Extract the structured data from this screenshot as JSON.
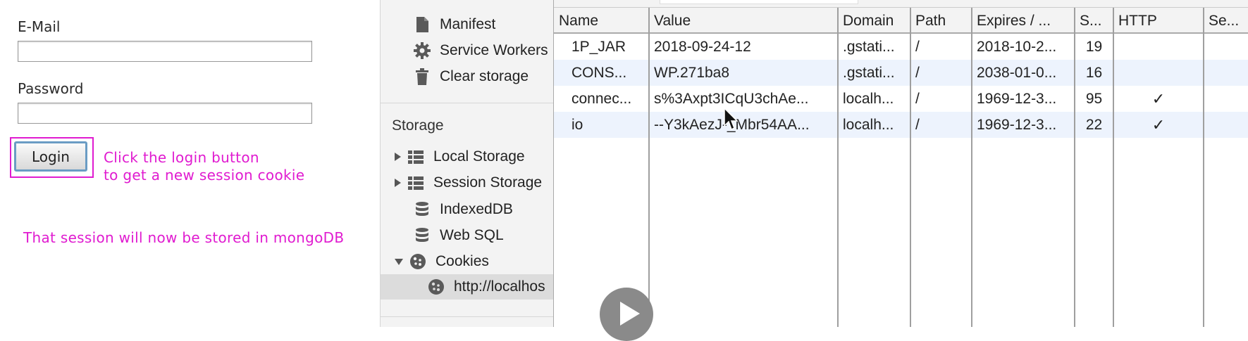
{
  "login_form": {
    "email_label": "E-Mail",
    "email_value": "",
    "password_label": "Password",
    "password_value": "",
    "login_button_label": "Login",
    "annotation_line1": "Click the login button",
    "annotation_line2": "to get a new session cookie",
    "annotation_bottom": "That session will now be stored in mongoDB"
  },
  "sidebar": {
    "application_items": [
      {
        "label": "Manifest",
        "icon": "document-icon"
      },
      {
        "label": "Service Workers",
        "icon": "gear-icon"
      },
      {
        "label": "Clear storage",
        "icon": "trash-icon"
      }
    ],
    "storage_header": "Storage",
    "storage_items": [
      {
        "label": "Local Storage",
        "icon": "grid-icon"
      },
      {
        "label": "Session Storage",
        "icon": "grid-icon"
      },
      {
        "label": "IndexedDB",
        "icon": "database-icon"
      },
      {
        "label": "Web SQL",
        "icon": "database-icon"
      },
      {
        "label": "Cookies",
        "icon": "cookie-icon"
      },
      {
        "label": "http://localhos",
        "icon": "cookie-icon"
      }
    ]
  },
  "cookie_table": {
    "headers": [
      "Name",
      "Value",
      "Domain",
      "Path",
      "Expires / ...",
      "S...",
      "HTTP",
      "Se..."
    ],
    "rows": [
      {
        "name": "1P_JAR",
        "value": "2018-09-24-12",
        "domain": ".gstati...",
        "path": "/",
        "expires": "2018-10-2...",
        "size": "19",
        "http": "",
        "secure": ""
      },
      {
        "name": "CONS...",
        "value": "WP.271ba8",
        "domain": ".gstati...",
        "path": "/",
        "expires": "2038-01-0...",
        "size": "16",
        "http": "",
        "secure": ""
      },
      {
        "name": "connec...",
        "value": "s%3Axpt3ICqU3chAe...",
        "domain": "localh...",
        "path": "/",
        "expires": "1969-12-3...",
        "size": "95",
        "http": "✓",
        "secure": ""
      },
      {
        "name": "io",
        "value": "--Y3kAezJ-_Mbr54AA...",
        "domain": "localh...",
        "path": "/",
        "expires": "1969-12-3...",
        "size": "22",
        "http": "✓",
        "secure": ""
      }
    ]
  },
  "colors": {
    "annotation": "#e01bd0",
    "row_stripe": "#edf3fd",
    "sidebar_bg": "#f3f3f3",
    "selected_bg": "#dcdcdc"
  }
}
